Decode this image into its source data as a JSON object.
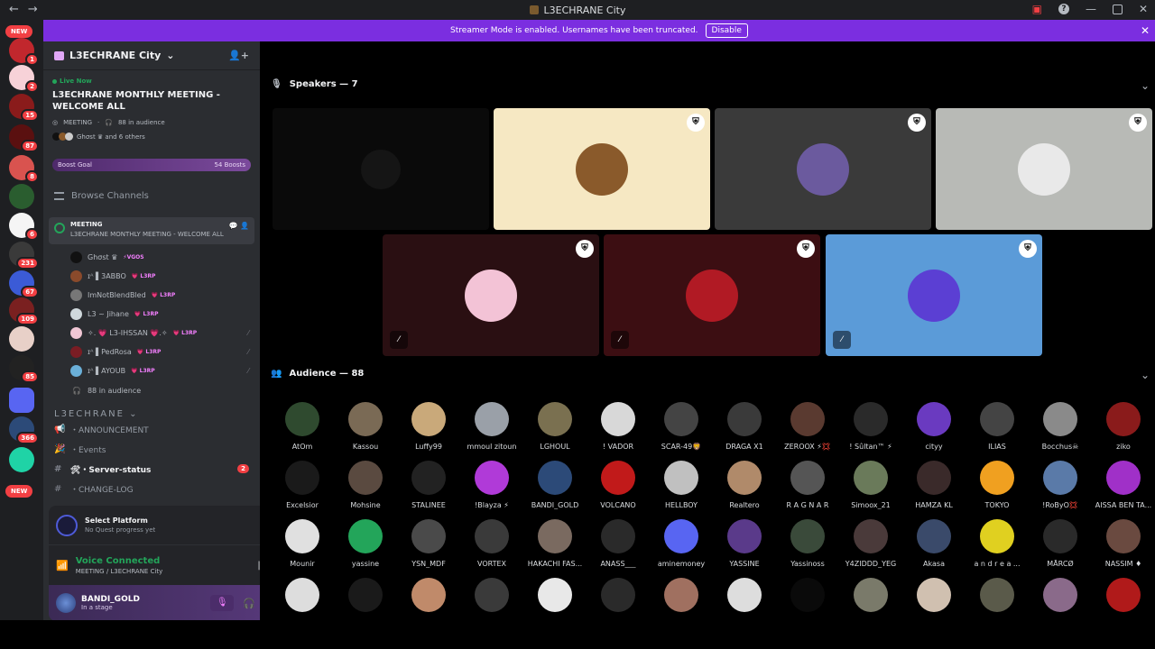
{
  "window": {
    "title": "L3ECHRANE City"
  },
  "banner": {
    "text": "Streamer Mode is enabled. Usernames have been truncated.",
    "button": "Disable"
  },
  "guilds": [
    {
      "badge": "1",
      "color": "#c1272d"
    },
    {
      "badge": "2",
      "color": "#f7d2d8"
    },
    {
      "badge": "15",
      "color": "#8a1b1b"
    },
    {
      "badge": "87",
      "color": "#5a1010"
    },
    {
      "badge": "8",
      "color": "#d9534f"
    },
    {
      "badge": "",
      "color": "#2a5d2f"
    },
    {
      "badge": "6",
      "color": "#f5f5f5"
    },
    {
      "badge": "231",
      "color": "#3a3a3a"
    },
    {
      "badge": "67",
      "color": "#3b5bd6"
    },
    {
      "badge": "109",
      "color": "#7a2020"
    },
    {
      "badge": "",
      "color": "#e8d0c8"
    },
    {
      "badge": "85",
      "color": "#222"
    },
    {
      "badge": "",
      "color": "#5865f2"
    },
    {
      "badge": "366",
      "color": "#2c4a78"
    },
    {
      "badge": "",
      "color": "#1fd3a6"
    }
  ],
  "guild_new_top": "NEW",
  "guild_new_bottom": "NEW",
  "server": {
    "name": "L3ECHRANE City"
  },
  "live": {
    "tag": "Live Now",
    "title": "L3ECHRANE MONTHLY MEETING - WELCOME ALL",
    "channel": "MEETING",
    "audience": "88 in audience",
    "who": "Ghσst ♛ and 6 others"
  },
  "boost": {
    "label": "Boost Goal",
    "count": "54 Boosts"
  },
  "browse": "Browse Channels",
  "stage": {
    "name": "MEETING",
    "topic": "L3ECHRANE MONTHLY MEETING - WELCOME ALL"
  },
  "members": [
    {
      "name": "Ghσst ♛",
      "role": "⚡VGOS",
      "mute": false,
      "color": "#111"
    },
    {
      "name": "ɪᴬ ▌3ABBO",
      "role": "💗 L3RP",
      "mute": false,
      "color": "#8a4a2b"
    },
    {
      "name": "ImNotBlendBled",
      "role": "💗 L3RP",
      "mute": false,
      "color": "#777"
    },
    {
      "name": "L3 ~ Jihane",
      "role": "💗 L3RP",
      "mute": false,
      "color": "#cfd8dc"
    },
    {
      "name": "✧. 💗 L3-IHSSAN 💗.✧",
      "role": "💗 L3RP",
      "mute": true,
      "color": "#f0c6d4"
    },
    {
      "name": "ɪᴬ ▌PedRosa",
      "role": "💗 L3RP",
      "mute": true,
      "color": "#7a1d24"
    },
    {
      "name": "ɪᴬ ▌AYOUB",
      "role": "💗 L3RP",
      "mute": true,
      "color": "#6bb0d9"
    }
  ],
  "audience_row": "88 in audience",
  "category": "L3ECHRANE",
  "channels": [
    {
      "icon": "📢",
      "name": "・ANNOUNCEMENT",
      "bold": false,
      "badge": ""
    },
    {
      "icon": "🎉",
      "name": "・Events",
      "bold": false,
      "badge": ""
    },
    {
      "icon": "#",
      "name": "🛠・Server-status",
      "bold": true,
      "badge": "2"
    },
    {
      "icon": "#",
      "name": "・CHANGE-LOG",
      "bold": false,
      "badge": ""
    }
  ],
  "quest": {
    "title": "Select Platform",
    "sub": "No Quest progress yet"
  },
  "voice": {
    "status": "Voice Connected",
    "where": "MEETING / L3ECHRANE City"
  },
  "user": {
    "name": "BANDI_GOLD",
    "status": "In a stage"
  },
  "speakers": {
    "title": "Speakers — 7"
  },
  "speaker_tiles": [
    {
      "bg": "#0a0a0a",
      "av": "#151515",
      "mod": false,
      "muted": false
    },
    {
      "bg": "#f6e8c3",
      "av": "#8a5a2b",
      "mod": true,
      "muted": false
    },
    {
      "bg": "#3a3a3a",
      "av": "#6b5a9e",
      "mod": true,
      "muted": false
    },
    {
      "bg": "#b8bab6",
      "av": "#e9e9e9",
      "mod": true,
      "muted": false
    },
    {
      "bg": "#2a0f12",
      "av": "#f3c3d6",
      "mod": true,
      "muted": true
    },
    {
      "bg": "#3c0e12",
      "av": "#b11a24",
      "mod": true,
      "muted": true
    },
    {
      "bg": "#5b9bd8",
      "av": "#5b3fd3",
      "mod": true,
      "muted": true
    }
  ],
  "audience": {
    "title": "Audience — 88"
  },
  "audience_members": [
    {
      "name": "AtOm",
      "color": "#2f4a2f"
    },
    {
      "name": "Kassou",
      "color": "#7a6a55"
    },
    {
      "name": "Luffy99",
      "color": "#c9a97a"
    },
    {
      "name": "mmoul zitoun",
      "color": "#9aa0a8"
    },
    {
      "name": "LGHOUL",
      "color": "#7a7050"
    },
    {
      "name": "! VADOR",
      "color": "#d8d8d8"
    },
    {
      "name": "SCAR-49🦁",
      "color": "#444"
    },
    {
      "name": "DRAGA X1",
      "color": "#3a3a3a"
    },
    {
      "name": "ZEROOX ⚡💢",
      "color": "#5a3a30"
    },
    {
      "name": "! Sûltan™ ⚡",
      "color": "#2a2a2a"
    },
    {
      "name": "cityy",
      "color": "#6a3ac0"
    },
    {
      "name": "ILIAS",
      "color": "#444"
    },
    {
      "name": "Bocchus☠",
      "color": "#8a8a8a"
    },
    {
      "name": "ziko",
      "color": "#8a1b1b"
    },
    {
      "name": "Excelsior",
      "color": "#1a1a1a"
    },
    {
      "name": "Mohsine",
      "color": "#5a4a40"
    },
    {
      "name": "STALINEE",
      "color": "#222"
    },
    {
      "name": "!Blayza ⚡",
      "color": "#b03ad8"
    },
    {
      "name": "BANDI_GOLD",
      "color": "#2c4a78"
    },
    {
      "name": "VOLCANO",
      "color": "#c11a1a"
    },
    {
      "name": "HELLBOY",
      "color": "#c0c0c0"
    },
    {
      "name": "Realtero",
      "color": "#b08a6a"
    },
    {
      "name": "R A G N A R",
      "color": "#555"
    },
    {
      "name": "Simoox_21",
      "color": "#6a7a5a"
    },
    {
      "name": "HAMZA KL",
      "color": "#3a2a2a"
    },
    {
      "name": "TOKYO",
      "color": "#f0a020"
    },
    {
      "name": "!RoByO💢",
      "color": "#5a7aa8"
    },
    {
      "name": "AISSA BEN TA...",
      "color": "#a030c8"
    },
    {
      "name": "Mounir",
      "color": "#e0e0e0"
    },
    {
      "name": "yassine",
      "color": "#23a55a"
    },
    {
      "name": "YSN_MDF",
      "color": "#4a4a4a"
    },
    {
      "name": "VORTEX",
      "color": "#3a3a3a"
    },
    {
      "name": "HAKACHI FAS...",
      "color": "#7a6a60"
    },
    {
      "name": "ANASS___",
      "color": "#2a2a2a"
    },
    {
      "name": "aminemoney",
      "color": "#5865f2"
    },
    {
      "name": "YASSINE",
      "color": "#5a3a8a"
    },
    {
      "name": "Yassinoss",
      "color": "#3a4a3a"
    },
    {
      "name": "Y4ZIDDD_YEG",
      "color": "#4a3a3a"
    },
    {
      "name": "Akasa",
      "color": "#3a4a6a"
    },
    {
      "name": "a n d r e a ...",
      "color": "#e0d020"
    },
    {
      "name": "MĀRCØ",
      "color": "#2a2a2a"
    },
    {
      "name": "NASSIM ♦",
      "color": "#6a4a40"
    },
    {
      "name": "",
      "color": "#ddd"
    },
    {
      "name": "",
      "color": "#1a1a1a"
    },
    {
      "name": "",
      "color": "#c08a6a"
    },
    {
      "name": "",
      "color": "#3a3a3a"
    },
    {
      "name": "",
      "color": "#e8e8e8"
    },
    {
      "name": "",
      "color": "#2a2a2a"
    },
    {
      "name": "",
      "color": "#a07060"
    },
    {
      "name": "",
      "color": "#ddd"
    },
    {
      "name": "",
      "color": "#0a0a0a"
    },
    {
      "name": "",
      "color": "#7a7a6a"
    },
    {
      "name": "",
      "color": "#d0c0b0"
    },
    {
      "name": "",
      "color": "#5a5a4a"
    },
    {
      "name": "",
      "color": "#8a6a8a"
    },
    {
      "name": "",
      "color": "#b01a1a"
    }
  ]
}
